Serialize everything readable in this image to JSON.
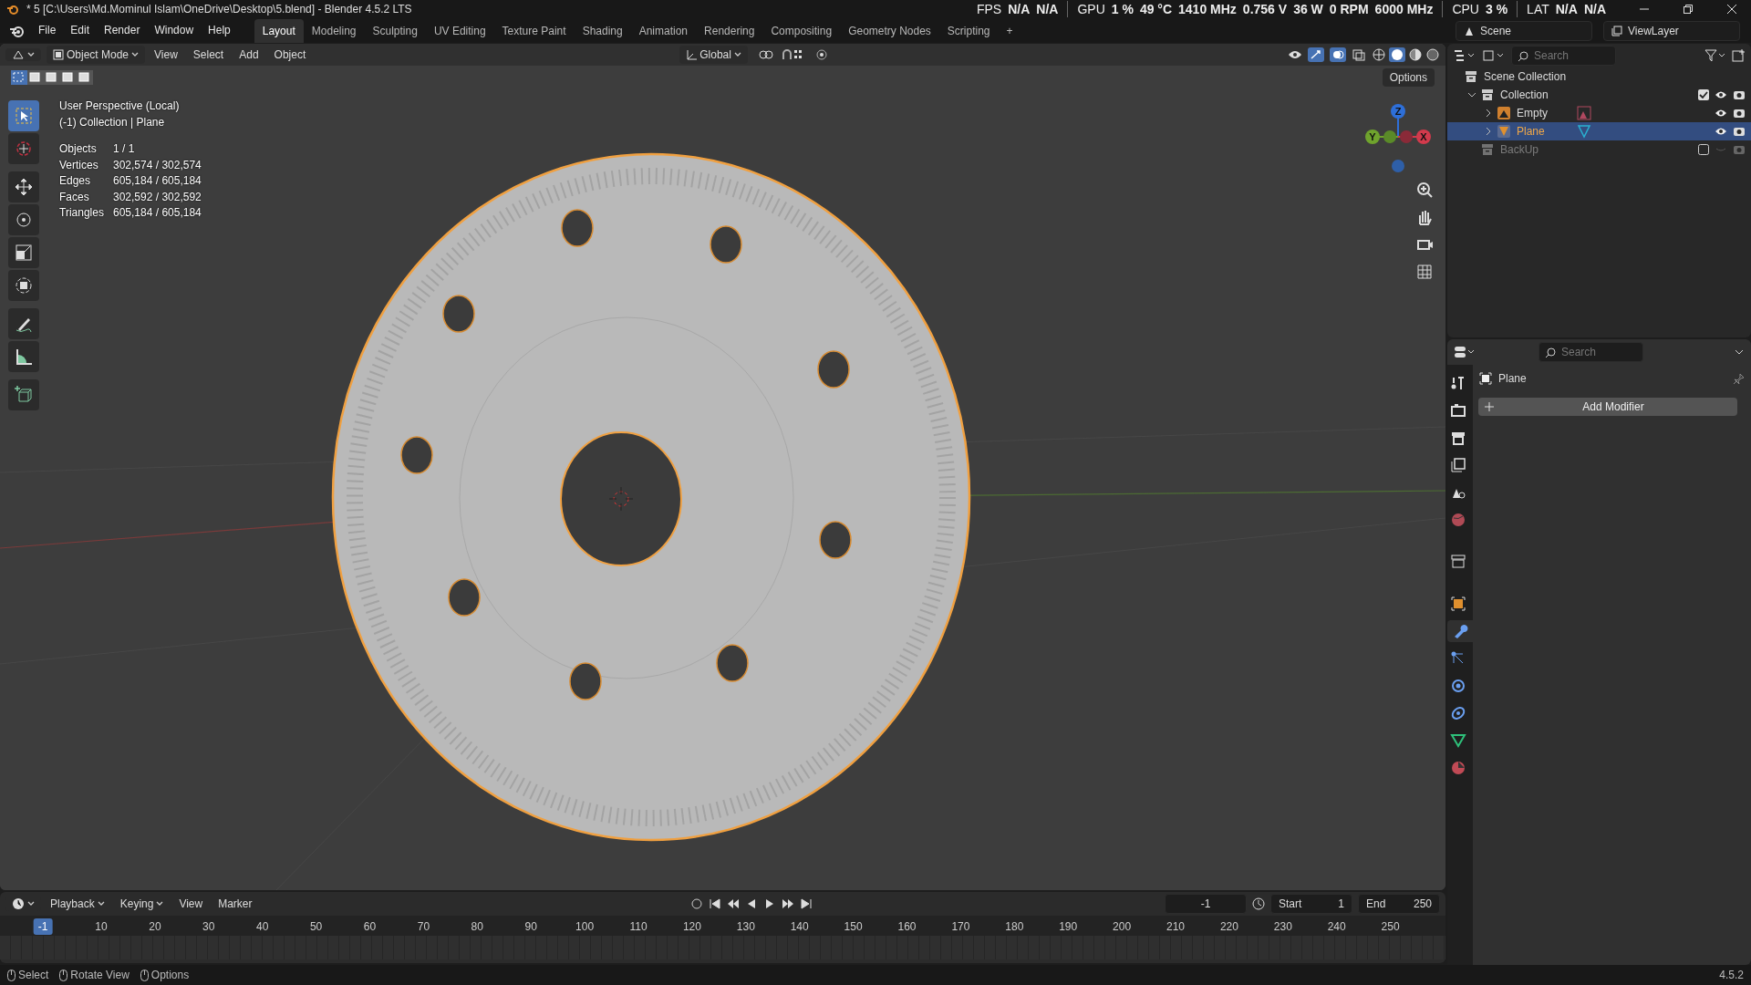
{
  "window": {
    "title": "* 5 [C:\\Users\\Md.Mominul Islam\\OneDrive\\Desktop\\5.blend] - Blender 4.5.2 LTS"
  },
  "menu": [
    "File",
    "Edit",
    "Render",
    "Window",
    "Help"
  ],
  "workspaces": [
    {
      "label": "Layout",
      "selected": true
    },
    {
      "label": "Modeling",
      "selected": false
    },
    {
      "label": "Sculpting",
      "selected": false
    },
    {
      "label": "UV Editing",
      "selected": false
    },
    {
      "label": "Texture Paint",
      "selected": false
    },
    {
      "label": "Shading",
      "selected": false
    },
    {
      "label": "Animation",
      "selected": false
    },
    {
      "label": "Rendering",
      "selected": false
    },
    {
      "label": "Compositing",
      "selected": false
    },
    {
      "label": "Geometry Nodes",
      "selected": false
    },
    {
      "label": "Scripting",
      "selected": false
    }
  ],
  "add_workspace": "+",
  "performance": [
    {
      "label": "FPS",
      "values": [
        "N/A",
        "N/A"
      ]
    },
    {
      "label": "GPU",
      "values": [
        "1 %",
        "49 °C",
        "1410 MHz",
        "0.756 V",
        "36 W",
        "0 RPM",
        "6000 MHz"
      ]
    },
    {
      "label": "CPU",
      "values": [
        "3 %"
      ]
    },
    {
      "label": "LAT",
      "values": [
        "N/A",
        "N/A"
      ]
    }
  ],
  "scene": "Scene",
  "view_layer": "ViewLayer",
  "viewport": {
    "mode": "Object Mode",
    "menus": [
      "View",
      "Select",
      "Add",
      "Object"
    ],
    "orientation": "Global",
    "options": "Options",
    "view_name": "User Perspective (Local)",
    "context": "(-1) Collection | Plane",
    "stats": [
      {
        "label": "Objects",
        "value": "1 / 1"
      },
      {
        "label": "Vertices",
        "value": "302,574 / 302,574"
      },
      {
        "label": "Edges",
        "value": "605,184 / 605,184"
      },
      {
        "label": "Faces",
        "value": "302,592 / 302,592"
      },
      {
        "label": "Triangles",
        "value": "605,184 / 605,184"
      }
    ],
    "gizmo_axes": [
      {
        "label": "Z",
        "color": "#2e6fd8"
      },
      {
        "label": "Y",
        "color": "#6fa32d"
      },
      {
        "label": "X",
        "color": "#d23a4c"
      }
    ],
    "tools": [
      {
        "kind": "select",
        "selected": true
      },
      {
        "kind": "cursor",
        "selected": false
      },
      {
        "kind": "move",
        "selected": false
      },
      {
        "kind": "rotate",
        "selected": false
      },
      {
        "kind": "scale",
        "selected": false
      },
      {
        "kind": "transform",
        "selected": false
      },
      {
        "kind": "annotate",
        "selected": false
      },
      {
        "kind": "measure",
        "selected": false
      },
      {
        "kind": "add_cube",
        "selected": false
      }
    ]
  },
  "outliner": {
    "search_placeholder": "Search",
    "tree": [
      {
        "name": "Scene Collection",
        "kind": "scene",
        "selected": false,
        "children": [
          {
            "name": "Collection",
            "kind": "collection",
            "expanded": true,
            "checked": true,
            "selected": false,
            "children": [
              {
                "name": "Empty",
                "kind": "empty",
                "expanded": false,
                "selected": false
              },
              {
                "name": "Plane",
                "kind": "mesh",
                "expanded": false,
                "selected": true
              }
            ]
          },
          {
            "name": "BackUp",
            "kind": "collection",
            "checked": false,
            "selected": false
          }
        ]
      }
    ]
  },
  "properties": {
    "search_placeholder": "Search",
    "object_name": "Plane",
    "add_modifier": "Add Modifier",
    "tabs": [
      {
        "kind": "tool",
        "selected": false
      },
      {
        "kind": "render",
        "selected": false
      },
      {
        "kind": "output",
        "selected": false
      },
      {
        "kind": "view_layer",
        "selected": false
      },
      {
        "kind": "scene",
        "selected": false
      },
      {
        "kind": "world",
        "selected": false
      },
      {
        "kind": "collection",
        "selected": false
      },
      {
        "kind": "object",
        "selected": false
      },
      {
        "kind": "modifiers",
        "selected": true
      },
      {
        "kind": "particles",
        "selected": false
      },
      {
        "kind": "physics",
        "selected": false
      },
      {
        "kind": "constraints",
        "selected": false
      },
      {
        "kind": "data",
        "selected": false
      },
      {
        "kind": "material",
        "selected": false
      }
    ]
  },
  "timeline": {
    "menus": [
      "Playback",
      "Keying",
      "View",
      "Marker"
    ],
    "current_frame": "-1",
    "start_label": "Start",
    "start": "1",
    "end_label": "End",
    "end": "250",
    "ruler": [
      {
        "label": "-1",
        "selected": true
      },
      {
        "label": "10",
        "selected": false
      },
      {
        "label": "20",
        "selected": false
      },
      {
        "label": "30",
        "selected": false
      },
      {
        "label": "40",
        "selected": false
      },
      {
        "label": "50",
        "selected": false
      },
      {
        "label": "60",
        "selected": false
      },
      {
        "label": "70",
        "selected": false
      },
      {
        "label": "80",
        "selected": false
      },
      {
        "label": "90",
        "selected": false
      },
      {
        "label": "100",
        "selected": false
      },
      {
        "label": "110",
        "selected": false
      },
      {
        "label": "120",
        "selected": false
      },
      {
        "label": "130",
        "selected": false
      },
      {
        "label": "140",
        "selected": false
      },
      {
        "label": "150",
        "selected": false
      },
      {
        "label": "160",
        "selected": false
      },
      {
        "label": "170",
        "selected": false
      },
      {
        "label": "180",
        "selected": false
      },
      {
        "label": "190",
        "selected": false
      },
      {
        "label": "200",
        "selected": false
      },
      {
        "label": "210",
        "selected": false
      },
      {
        "label": "220",
        "selected": false
      },
      {
        "label": "230",
        "selected": false
      },
      {
        "label": "240",
        "selected": false
      },
      {
        "label": "250",
        "selected": false
      }
    ]
  },
  "status_bar": {
    "items": [
      "Select",
      "Rotate View",
      "Options"
    ],
    "version": "4.5.2"
  }
}
